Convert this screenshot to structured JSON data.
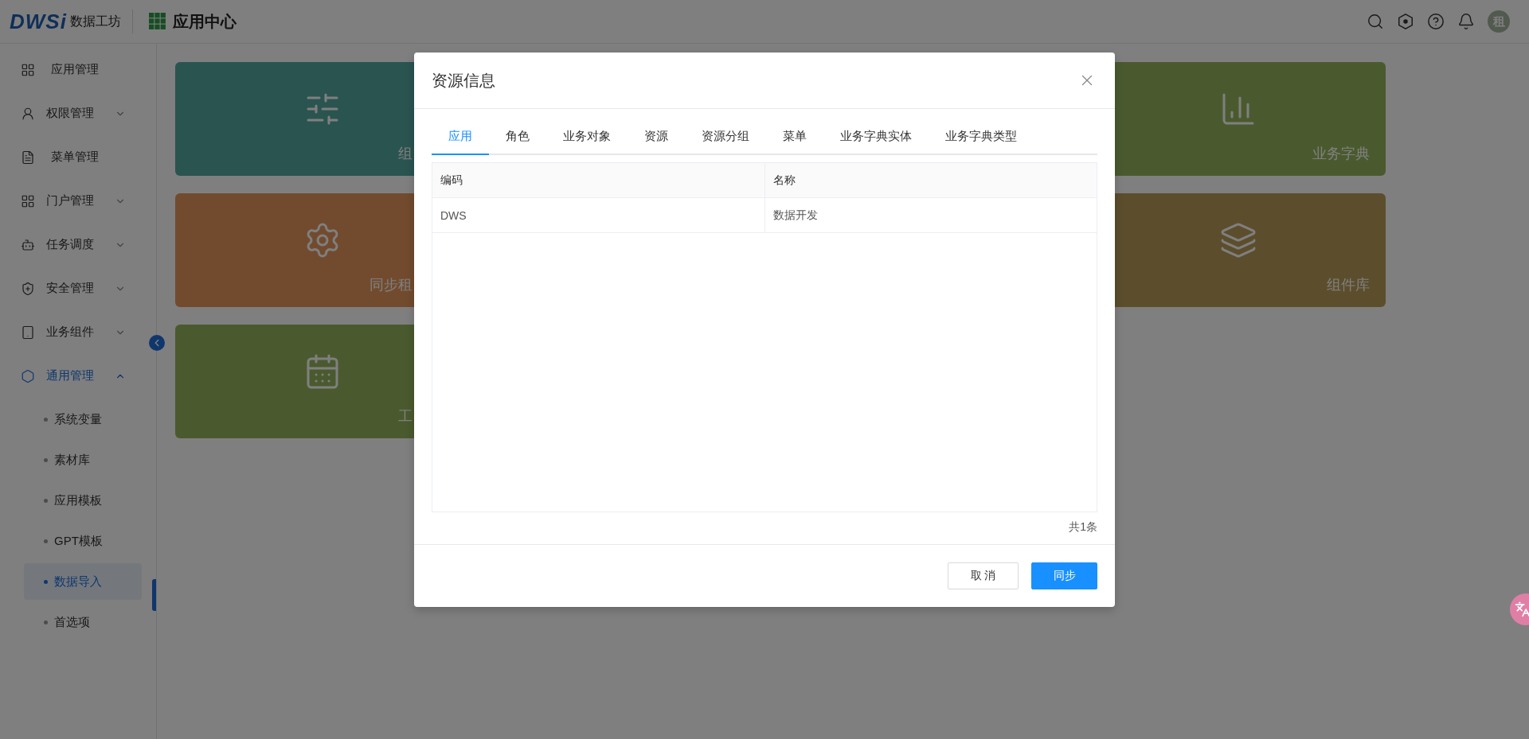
{
  "header": {
    "logo_mark": "DWSi",
    "logo_name": "数据工坊",
    "app_title": "应用中心",
    "avatar": "租"
  },
  "sidebar": {
    "items": [
      {
        "label": "应用管理",
        "kind": "link"
      },
      {
        "label": "权限管理",
        "kind": "group",
        "expanded": false
      },
      {
        "label": "菜单管理",
        "kind": "link"
      },
      {
        "label": "门户管理",
        "kind": "group",
        "expanded": false
      },
      {
        "label": "任务调度",
        "kind": "group",
        "expanded": false
      },
      {
        "label": "安全管理",
        "kind": "group",
        "expanded": false
      },
      {
        "label": "业务组件",
        "kind": "group",
        "expanded": false
      },
      {
        "label": "通用管理",
        "kind": "group",
        "expanded": true,
        "children": [
          {
            "label": "系统变量",
            "selected": false
          },
          {
            "label": "素材库",
            "selected": false
          },
          {
            "label": "应用模板",
            "selected": false
          },
          {
            "label": "GPT模板",
            "selected": false
          },
          {
            "label": "数据导入",
            "selected": true
          },
          {
            "label": "首选项",
            "selected": false
          }
        ]
      }
    ]
  },
  "card_rows": [
    [
      {
        "label": "组",
        "color": "#2a5450"
      },
      {
        "label": "业务字典",
        "color": "#4a5a2e"
      }
    ],
    [
      {
        "label": "同步租",
        "color": "#724b2e"
      },
      {
        "label": "组件库",
        "color": "#5c4e2c"
      }
    ],
    [
      {
        "label": "工",
        "color": "#4a5a2e"
      }
    ]
  ],
  "dialog": {
    "title": "资源信息",
    "tabs": [
      {
        "label": "应用",
        "selected": true
      },
      {
        "label": "角色",
        "selected": false
      },
      {
        "label": "业务对象",
        "selected": false
      },
      {
        "label": "资源",
        "selected": false
      },
      {
        "label": "资源分组",
        "selected": false
      },
      {
        "label": "菜单",
        "selected": false
      },
      {
        "label": "业务字典实体",
        "selected": false
      },
      {
        "label": "业务字典类型",
        "selected": false
      }
    ],
    "table": {
      "columns": [
        "编码",
        "名称"
      ],
      "rows": [
        [
          "DWS",
          "数据开发"
        ]
      ]
    },
    "total": "共1条",
    "buttons": [
      {
        "label": "取 消",
        "kind": "default"
      },
      {
        "label": "同步",
        "kind": "primary"
      }
    ]
  }
}
